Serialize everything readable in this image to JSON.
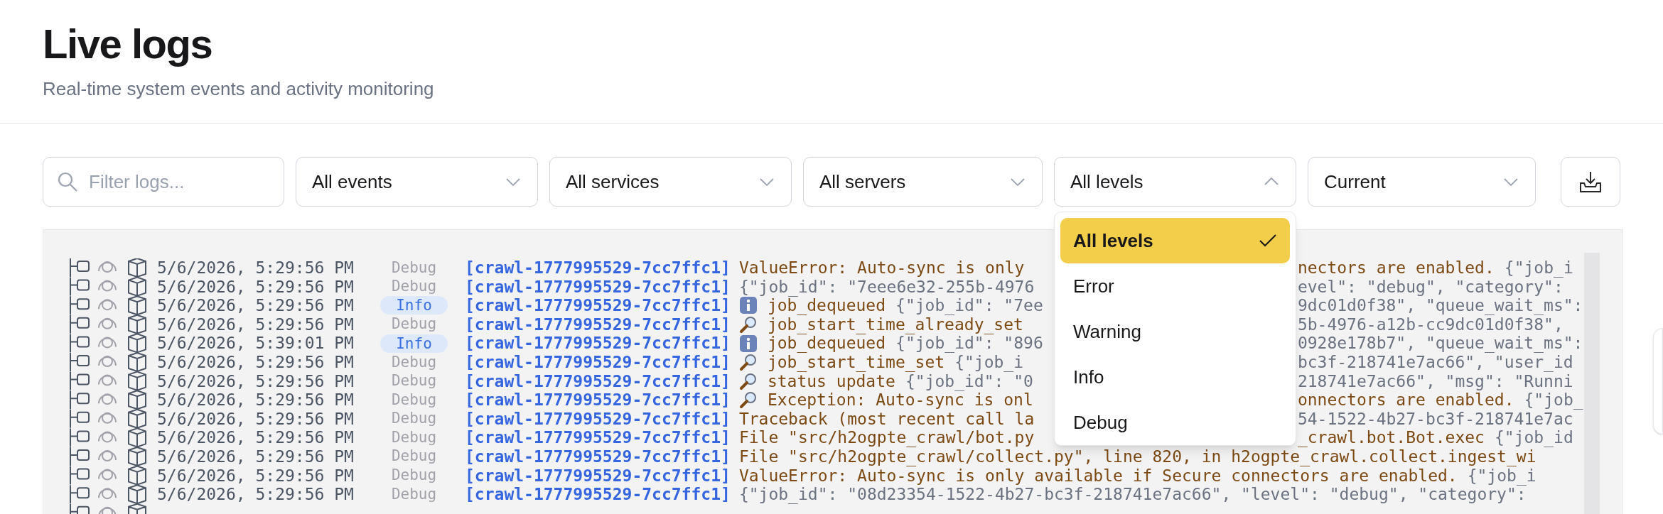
{
  "page": {
    "title": "Live logs",
    "subtitle": "Real-time system events and activity monitoring"
  },
  "filters": {
    "search": {
      "placeholder": "Filter logs..."
    },
    "selects": [
      {
        "value": "All events",
        "expanded": false
      },
      {
        "value": "All services",
        "expanded": false
      },
      {
        "value": "All servers",
        "expanded": false
      },
      {
        "value": "All levels",
        "expanded": true
      },
      {
        "value": "Current",
        "expanded": false
      }
    ]
  },
  "level_menu": {
    "items": [
      {
        "label": "All levels",
        "selected": true
      },
      {
        "label": "Error",
        "selected": false
      },
      {
        "label": "Warning",
        "selected": false
      },
      {
        "label": "Info",
        "selected": false
      },
      {
        "label": "Debug",
        "selected": false
      }
    ]
  },
  "logs": [
    {
      "time": "5/6/2026, 5:29:56 PM",
      "level": "Debug",
      "kind": "debug",
      "source": "[crawl-1777995529-7cc7ffc1]",
      "left": [
        {
          "text": "ValueError: Auto-sync is only",
          "kind": "message"
        }
      ],
      "right": [
        {
          "text": "nectors are enabled.",
          "kind": "message"
        },
        {
          "text": "{\"job_i",
          "kind": "json"
        }
      ]
    },
    {
      "time": "5/6/2026, 5:29:56 PM",
      "level": "Debug",
      "kind": "debug",
      "source": "[crawl-1777995529-7cc7ffc1]",
      "left": [
        {
          "text": "{\"job_id\": \"7eee6e32-255b-4976",
          "kind": "json"
        }
      ],
      "right": [
        {
          "text": "evel\": \"debug\", \"category\":",
          "kind": "json"
        }
      ]
    },
    {
      "time": "5/6/2026, 5:29:56 PM",
      "level": "Info",
      "kind": "info",
      "source": "[crawl-1777995529-7cc7ffc1]",
      "left": [
        {
          "kind": "info_icon"
        },
        {
          "text": "job_dequeued",
          "kind": "message"
        },
        {
          "text": "{\"job_id\": \"7ee",
          "kind": "json"
        }
      ],
      "right": [
        {
          "text": "9dc01d0f38\", \"queue_wait_ms\":",
          "kind": "json"
        }
      ]
    },
    {
      "time": "5/6/2026, 5:29:56 PM",
      "level": "Debug",
      "kind": "debug",
      "source": "[crawl-1777995529-7cc7ffc1]",
      "left": [
        {
          "kind": "magnifier_icon"
        },
        {
          "text": "job_start_time_already_set",
          "kind": "message"
        }
      ],
      "right": [
        {
          "text": "5b-4976-a12b-cc9dc01d0f38\",",
          "kind": "json"
        }
      ]
    },
    {
      "time": "5/6/2026, 5:39:01 PM",
      "level": "Info",
      "kind": "info",
      "source": "[crawl-1777995529-7cc7ffc1]",
      "left": [
        {
          "kind": "info_icon"
        },
        {
          "text": "job_dequeued",
          "kind": "message"
        },
        {
          "text": "{\"job_id\": \"896",
          "kind": "json"
        }
      ],
      "right": [
        {
          "text": "0928e178b7\", \"queue_wait_ms\":",
          "kind": "json"
        }
      ]
    },
    {
      "time": "5/6/2026, 5:29:56 PM",
      "level": "Debug",
      "kind": "debug",
      "source": "[crawl-1777995529-7cc7ffc1]",
      "left": [
        {
          "kind": "magnifier_icon"
        },
        {
          "text": "job_start_time_set",
          "kind": "message"
        },
        {
          "text": "{\"job_i",
          "kind": "json"
        }
      ],
      "right": [
        {
          "text": "bc3f-218741e7ac66\", \"user_id",
          "kind": "json"
        }
      ]
    },
    {
      "time": "5/6/2026, 5:29:56 PM",
      "level": "Debug",
      "kind": "debug",
      "source": "[crawl-1777995529-7cc7ffc1]",
      "left": [
        {
          "kind": "magnifier_icon"
        },
        {
          "text": "status update",
          "kind": "message"
        },
        {
          "text": "{\"job_id\": \"0",
          "kind": "json"
        }
      ],
      "right": [
        {
          "text": "218741e7ac66\", \"msg\": \"Runni",
          "kind": "json"
        }
      ]
    },
    {
      "time": "5/6/2026, 5:29:56 PM",
      "level": "Debug",
      "kind": "debug",
      "source": "[crawl-1777995529-7cc7ffc1]",
      "left": [
        {
          "kind": "magnifier_icon"
        },
        {
          "text": "Exception: Auto-sync is onl",
          "kind": "message"
        }
      ],
      "right": [
        {
          "text": "onnectors are enabled.",
          "kind": "message"
        },
        {
          "text": "{\"job_",
          "kind": "json"
        }
      ]
    },
    {
      "time": "5/6/2026, 5:29:56 PM",
      "level": "Debug",
      "kind": "debug",
      "source": "[crawl-1777995529-7cc7ffc1]",
      "left": [
        {
          "text": "Traceback (most recent call la",
          "kind": "message"
        }
      ],
      "right": [
        {
          "text": "54-1522-4b27-bc3f-218741e7ac",
          "kind": "json"
        }
      ]
    },
    {
      "time": "5/6/2026, 5:29:56 PM",
      "level": "Debug",
      "kind": "debug",
      "source": "[crawl-1777995529-7cc7ffc1]",
      "left": [
        {
          "text": "File \"src/h2ogpte_crawl/bot.py",
          "kind": "message"
        }
      ],
      "right": [
        {
          "text": "_crawl.bot.Bot.exec",
          "kind": "message"
        },
        {
          "text": "{\"job_id",
          "kind": "json"
        }
      ]
    },
    {
      "time": "5/6/2026, 5:29:56 PM",
      "level": "Debug",
      "kind": "debug",
      "source": "[crawl-1777995529-7cc7ffc1]",
      "left": [
        {
          "text": "File \"src/h2ogpte_crawl/collect.py\", line 820, in h2ogpte_crawl.collect.ingest_wi",
          "kind": "message"
        }
      ]
    },
    {
      "time": "5/6/2026, 5:29:56 PM",
      "level": "Debug",
      "kind": "debug",
      "source": "[crawl-1777995529-7cc7ffc1]",
      "left": [
        {
          "text": "ValueError: Auto-sync is only available if Secure connectors are enabled.",
          "kind": "message"
        },
        {
          "text": "{\"job_i",
          "kind": "json"
        }
      ]
    },
    {
      "time": "5/6/2026, 5:29:56 PM",
      "level": "Debug",
      "kind": "debug",
      "source": "[crawl-1777995529-7cc7ffc1]",
      "left": [
        {
          "text": "{\"job_id\": \"08d23354-1522-4b27-bc3f-218741e7ac66\", \"level\": \"debug\", \"category\":",
          "kind": "json"
        }
      ]
    }
  ]
}
